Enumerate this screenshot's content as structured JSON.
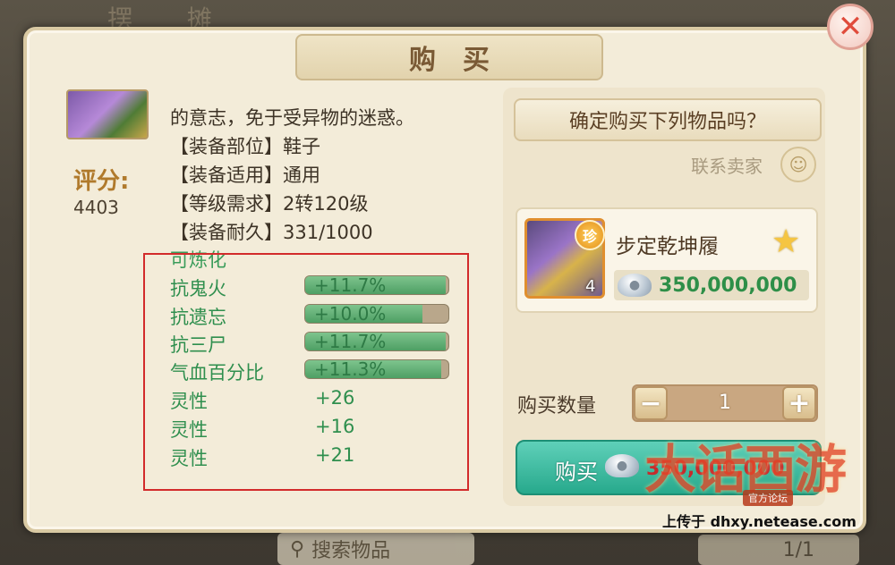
{
  "background": {
    "top_text": "摆 摊",
    "search_placeholder": "搜索物品",
    "page": "1/1"
  },
  "dialog": {
    "title": "购买",
    "close_label": "✕"
  },
  "item_detail": {
    "score_label": "评分:",
    "score_value": "4403",
    "description_lines": [
      "的意志，免于受异物的迷惑。",
      "【装备部位】鞋子",
      "【装备适用】通用",
      "【等级需求】2转120级",
      "【装备耐久】331/1000"
    ],
    "refine_title": "可炼化",
    "bar_attributes": [
      {
        "name": "抗鬼火",
        "value": "+11.7%",
        "fill": 0.98
      },
      {
        "name": "抗遗忘",
        "value": "+10.0%",
        "fill": 0.82
      },
      {
        "name": "抗三尸",
        "value": "+11.7%",
        "fill": 0.98
      },
      {
        "name": "气血百分比",
        "value": "+11.3%",
        "fill": 0.95
      }
    ],
    "plain_attributes": [
      {
        "name": "灵性",
        "value": "+26"
      },
      {
        "name": "灵性",
        "value": "+16"
      },
      {
        "name": "灵性",
        "value": "+21"
      }
    ]
  },
  "purchase": {
    "confirm_text": "确定购买下列物品吗？",
    "contact_seller": "联系卖家",
    "item_name": "步定乾坤履",
    "item_badge": "珍",
    "item_level": "4",
    "price": "350,000,000",
    "quantity_label": "购买数量",
    "quantity": "1",
    "minus": "−",
    "plus": "+",
    "buy_label": "购买",
    "buy_price": "350,000,000"
  },
  "watermark": {
    "logo": "大话西游",
    "sub": "官方论坛",
    "upload": "上传于 dhxy.netease.com"
  }
}
